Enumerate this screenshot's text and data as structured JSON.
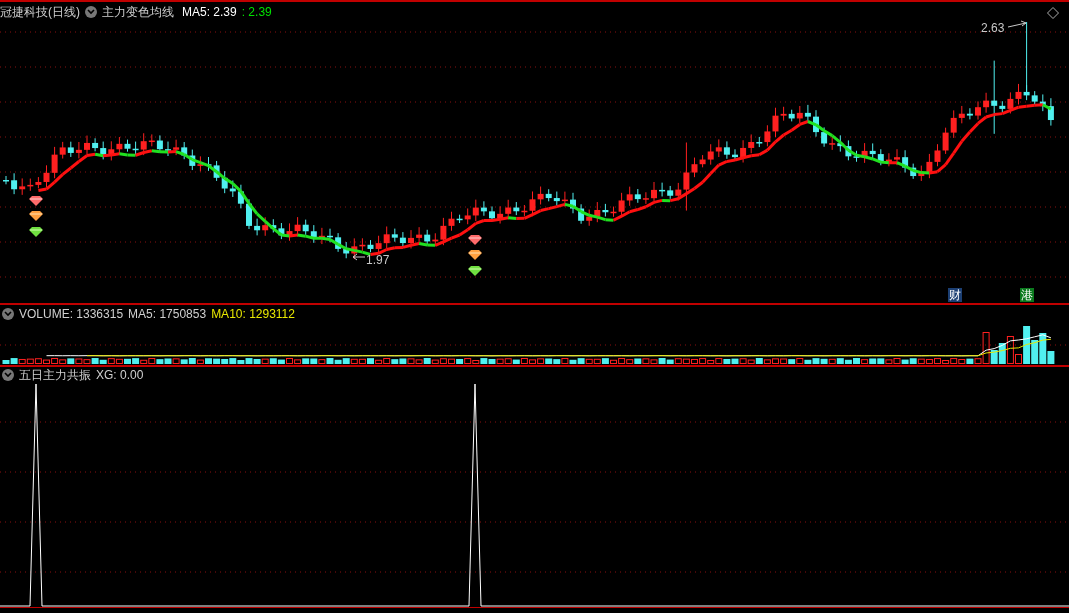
{
  "main_panel": {
    "stock_name": "冠捷科技(日线)",
    "indicator_name": "主力变色均线",
    "ma5_label": "MA5: 2.39",
    "ma5_value": ": 2.39",
    "high_label": "2.63",
    "low_label": "1.97",
    "badges": [
      {
        "text": "财",
        "color": "#1c3f73"
      },
      {
        "text": "港",
        "color": "#0b7a1e"
      }
    ]
  },
  "volume_panel": {
    "volume": "VOLUME: 1336315",
    "ma5": "MA5: 1750853",
    "ma10": "MA10: 1293112"
  },
  "indicator_panel": {
    "title": "五日主力共振",
    "xg": "XG: 0.00"
  }
}
